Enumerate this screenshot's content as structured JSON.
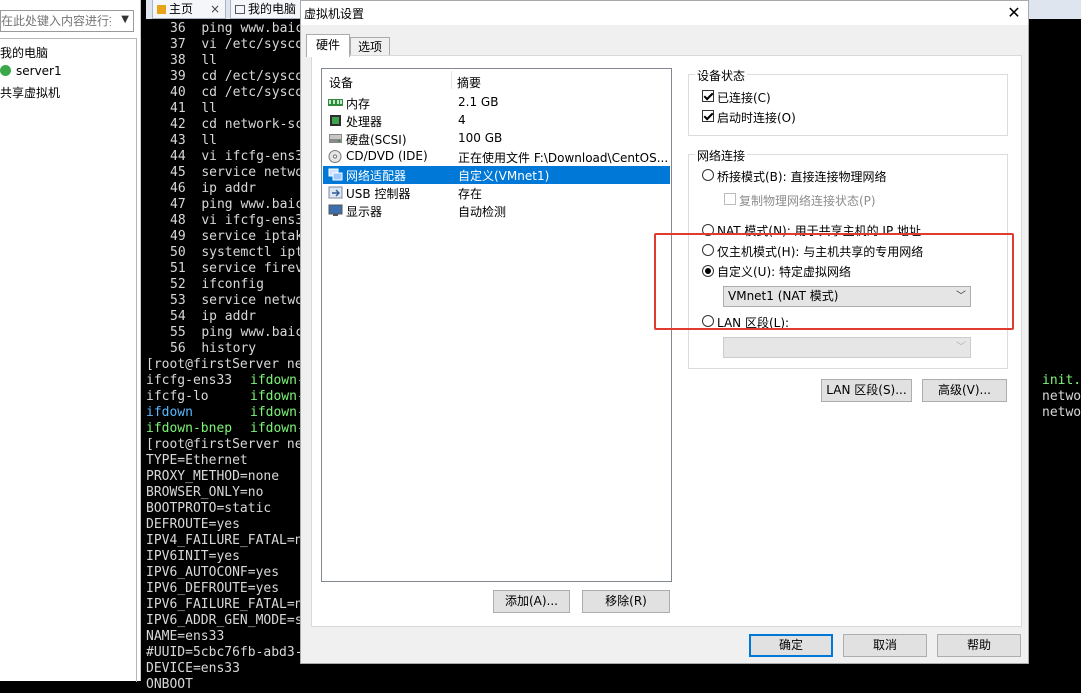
{
  "left_panel": {
    "search_placeholder": "在此处键入内容进行搜索",
    "tree": [
      {
        "label": "我的电脑"
      },
      {
        "label": "server1"
      },
      {
        "label": "共享虚拟机"
      }
    ]
  },
  "tabs": [
    {
      "label": "主页"
    },
    {
      "label": "我的电脑"
    }
  ],
  "terminal": {
    "history": [
      {
        "n": "36",
        "cmd": "ping www.baic"
      },
      {
        "n": "37",
        "cmd": "vi /etc/sysco"
      },
      {
        "n": "38",
        "cmd": "ll"
      },
      {
        "n": "39",
        "cmd": "cd /ect/sysco"
      },
      {
        "n": "40",
        "cmd": "cd /etc/sysco"
      },
      {
        "n": "41",
        "cmd": "ll"
      },
      {
        "n": "42",
        "cmd": "cd network-sc"
      },
      {
        "n": "43",
        "cmd": "ll"
      },
      {
        "n": "44",
        "cmd": "vi ifcfg-ens3"
      },
      {
        "n": "45",
        "cmd": "service netwo"
      },
      {
        "n": "46",
        "cmd": "ip addr"
      },
      {
        "n": "47",
        "cmd": "ping www.baic"
      },
      {
        "n": "48",
        "cmd": "vi ifcfg-ens3"
      },
      {
        "n": "49",
        "cmd": "service iptak"
      },
      {
        "n": "50",
        "cmd": "systemctl ipt"
      },
      {
        "n": "51",
        "cmd": "service firev"
      },
      {
        "n": "52",
        "cmd": "ifconfig"
      },
      {
        "n": "53",
        "cmd": "service netwo"
      },
      {
        "n": "54",
        "cmd": "ip addr"
      },
      {
        "n": "55",
        "cmd": "ping www.baic"
      },
      {
        "n": "56",
        "cmd": "history"
      }
    ],
    "prompt1": "[root@firstServer ne",
    "ls_rows": [
      {
        "a": "ifcfg-ens33",
        "b": "ifdown-"
      },
      {
        "a": "ifcfg-lo",
        "b": "ifdown-"
      },
      {
        "a": "ifdown",
        "b": "ifdown-"
      },
      {
        "a": "ifdown-bnep",
        "b": "ifdown-"
      }
    ],
    "prompt2": "[root@firstServer ne",
    "config": [
      "TYPE=Ethernet",
      "PROXY_METHOD=none",
      "BROWSER_ONLY=no",
      "BOOTPROTO=static",
      "DEFROUTE=yes",
      "IPV4_FAILURE_FATAL=n",
      "IPV6INIT=yes",
      "IPV6_AUTOCONF=yes",
      "IPV6_DEFROUTE=yes",
      "IPV6_FAILURE_FATAL=n",
      "IPV6_ADDR_GEN_MODE=s",
      "NAME=ens33",
      "#UUID=5cbc76fb-abd3-",
      "DEVICE=ens33",
      "ONBOOT"
    ],
    "right_col": [
      {
        "text": "init.",
        "color": "g"
      },
      {
        "text": "netwo",
        "color": "w"
      },
      {
        "text": "netwo",
        "color": "w"
      }
    ]
  },
  "dialog": {
    "title": "虚拟机设置",
    "tabs": [
      "硬件",
      "选项"
    ],
    "list_headers": {
      "device": "设备",
      "summary": "摘要"
    },
    "devices": [
      {
        "name": "内存",
        "summary": "2.1 GB",
        "icon": "memory-icon"
      },
      {
        "name": "处理器",
        "summary": "4",
        "icon": "cpu-icon"
      },
      {
        "name": "硬盘(SCSI)",
        "summary": "100 GB",
        "icon": "disk-icon"
      },
      {
        "name": "CD/DVD (IDE)",
        "summary": "正在使用文件 F:\\Download\\CentOS...",
        "icon": "cd-icon"
      },
      {
        "name": "网络适配器",
        "summary": "自定义(VMnet1)",
        "icon": "network-icon"
      },
      {
        "name": "USB 控制器",
        "summary": "存在",
        "icon": "usb-icon"
      },
      {
        "name": "显示器",
        "summary": "自动检测",
        "icon": "display-icon"
      }
    ],
    "add_button": "添加(A)...",
    "remove_button": "移除(R)",
    "device_status": {
      "label": "设备状态",
      "connected": "已连接(C)",
      "connect_on_power": "启动时连接(O)"
    },
    "network": {
      "label": "网络连接",
      "bridged": "桥接模式(B): 直接连接物理网络",
      "replicate": "复制物理网络连接状态(P)",
      "nat": "NAT 模式(N): 用于共享主机的 IP 地址",
      "host_only": "仅主机模式(H): 与主机共享的专用网络",
      "custom": "自定义(U): 特定虚拟网络",
      "custom_value": "VMnet1 (NAT 模式)",
      "lan": "LAN 区段(L):"
    },
    "lan_segment_button": "LAN 区段(S)...",
    "advanced_button": "高级(V)...",
    "ok_button": "确定",
    "cancel_button": "取消",
    "help_button": "帮助"
  }
}
